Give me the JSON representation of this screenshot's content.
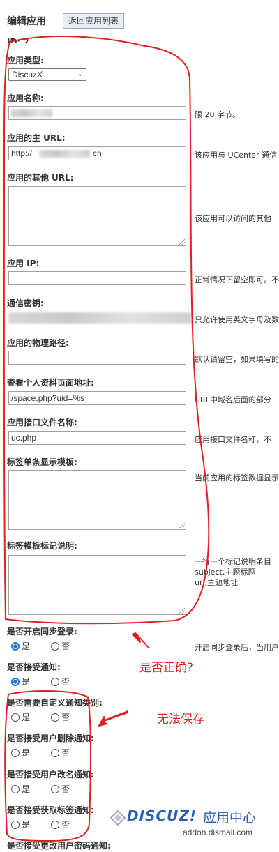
{
  "header": {
    "title": "编辑应用",
    "back_button": "返回应用列表",
    "id_text": "ID: 2"
  },
  "fields": {
    "app_type": {
      "label": "应用类型:",
      "value": "DiscuzX"
    },
    "app_name": {
      "label": "应用名称:",
      "hint": "限 20 字节。"
    },
    "main_url": {
      "label": "应用的主 URL:",
      "value_prefix": "http://",
      "value_suffix": "cn",
      "hint": "该应用与 UCenter 通信"
    },
    "other_url": {
      "label": "应用的其他 URL:",
      "hint": "该应用可以访问的其他"
    },
    "app_ip": {
      "label": "应用 IP:",
      "hint": "正常情况下留空即可。不"
    },
    "comm_key": {
      "label": "通信密钥:",
      "hint": "只允许使用英文字母及数"
    },
    "physical_path": {
      "label": "应用的物理路径:",
      "hint": "默认请留空，如果填写的"
    },
    "profile_url": {
      "label": "查看个人资料页面地址:",
      "value": "/space.php?uid=%s",
      "hint": "URL中域名后面的部分"
    },
    "api_file": {
      "label": "应用接口文件名称:",
      "value": "uc.php",
      "hint": "应用接口文件名称，不"
    },
    "tag_template": {
      "label": "标签单条显示模板:",
      "hint": "当前应用的标签数据显示"
    },
    "tag_desc": {
      "label": "标签模板标记说明:",
      "hint_lines": [
        "一行一个标记说明条目",
        "subject,主题标题",
        "url,主题地址"
      ]
    }
  },
  "radios": {
    "yes": "是",
    "no": "否",
    "sync_login": {
      "label": "是否开启同步登录:",
      "hint": "开启同步登录后，当用户"
    },
    "accept_notify": {
      "label": "是否接受通知:"
    },
    "custom_notify": {
      "label": "是否需要自定义通知类别:"
    },
    "notify_delete": {
      "label": "是否接受用户删除通知:"
    },
    "notify_rename": {
      "label": "是否接受用户改名通知:"
    },
    "notify_tags": {
      "label": "是否接受获取标签通知:"
    },
    "notify_password": {
      "label": "是否接受更改用户密码通知:"
    }
  },
  "annotations": {
    "question": "是否正确?",
    "cannot_save": "无法保存"
  },
  "watermark": {
    "brand": "DISCUZ!",
    "brand_cn": "应用中心",
    "domain": "addon.dismall.com"
  },
  "colors": {
    "annotation_red": "#e02020",
    "radio_blue": "#1a73e8",
    "brand_blue": "#2b5fb4"
  }
}
